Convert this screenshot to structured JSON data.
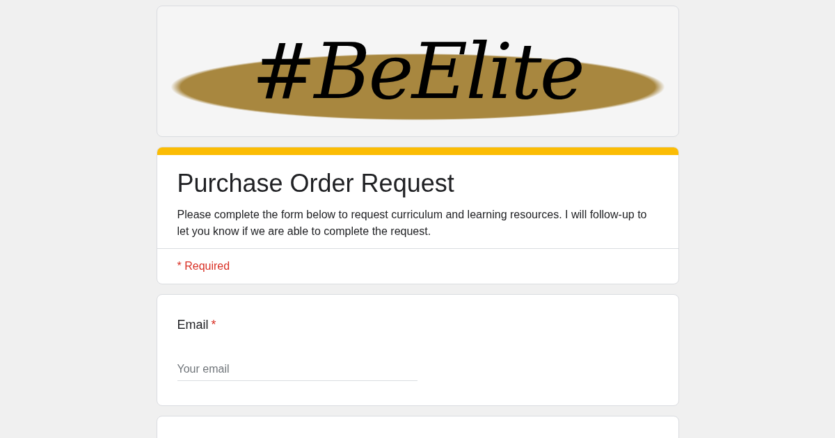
{
  "banner": {
    "text": "#BeElite"
  },
  "header": {
    "title": "Purchase Order Request",
    "description": "Please complete the form below to request curriculum and learning resources. I will follow-up to let you know if we are able to complete the request.",
    "required_note": "* Required"
  },
  "questions": [
    {
      "label": "Email",
      "required": true,
      "required_mark": "*",
      "placeholder": "Your email"
    }
  ]
}
